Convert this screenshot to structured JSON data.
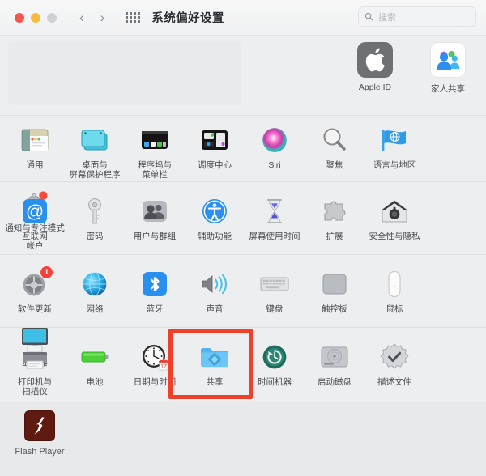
{
  "window": {
    "title": "系统偏好设置",
    "traffic_lights": [
      "close",
      "minimize",
      "zoom"
    ],
    "back_label": "‹",
    "forward_label": "›",
    "grid_icon": "grid-icon"
  },
  "search": {
    "placeholder": "搜索",
    "value": "",
    "icon": "search-icon"
  },
  "accounts": [
    {
      "label": "Apple ID",
      "icon": "apple-logo-icon"
    },
    {
      "label": "家人共享",
      "icon": "family-sharing-icon"
    }
  ],
  "sections": [
    {
      "name": "personal",
      "items": [
        {
          "label": "通用",
          "icon": "general-window-icon"
        },
        {
          "label": "桌面与\n屏幕保护程序",
          "icon": "desktop-screensaver-icon"
        },
        {
          "label": "程序坞与\n菜单栏",
          "icon": "dock-menubar-icon"
        },
        {
          "label": "调度中心",
          "icon": "mission-control-icon"
        },
        {
          "label": "Siri",
          "icon": "siri-icon"
        },
        {
          "label": "聚焦",
          "icon": "spotlight-icon"
        },
        {
          "label": "语言与地区",
          "icon": "language-region-flag-icon"
        },
        {
          "label": "通知与专注模式",
          "icon": "notifications-bell-icon"
        }
      ]
    },
    {
      "name": "accounts-access",
      "items": [
        {
          "label": "互联网\n帐户",
          "icon": "internet-accounts-at-icon"
        },
        {
          "label": "密码",
          "icon": "passwords-key-icon"
        },
        {
          "label": "用户与群组",
          "icon": "users-groups-icon"
        },
        {
          "label": "辅助功能",
          "icon": "accessibility-icon"
        },
        {
          "label": "屏幕使用时间",
          "icon": "screen-time-hourglass-icon"
        },
        {
          "label": "扩展",
          "icon": "extensions-puzzle-icon"
        },
        {
          "label": "安全性与隐私",
          "icon": "security-privacy-house-icon"
        }
      ]
    },
    {
      "name": "hardware",
      "items": [
        {
          "label": "软件更新",
          "icon": "software-update-gear-icon",
          "badge": "1"
        },
        {
          "label": "网络",
          "icon": "network-globe-icon"
        },
        {
          "label": "蓝牙",
          "icon": "bluetooth-icon"
        },
        {
          "label": "声音",
          "icon": "sound-speaker-icon"
        },
        {
          "label": "键盘",
          "icon": "keyboard-icon"
        },
        {
          "label": "触控板",
          "icon": "trackpad-icon"
        },
        {
          "label": "鼠标",
          "icon": "mouse-icon"
        },
        {
          "label": "显示器",
          "icon": "display-monitor-icon"
        }
      ]
    },
    {
      "name": "system",
      "items": [
        {
          "label": "打印机与\n扫描仪",
          "icon": "printer-scanner-icon"
        },
        {
          "label": "电池",
          "icon": "battery-icon"
        },
        {
          "label": "日期与时间",
          "icon": "date-time-clock-icon"
        },
        {
          "label": "共享",
          "icon": "sharing-folder-icon",
          "highlighted": true
        },
        {
          "label": "时间机器",
          "icon": "time-machine-icon"
        },
        {
          "label": "启动磁盘",
          "icon": "startup-disk-icon"
        },
        {
          "label": "描述文件",
          "icon": "profiles-check-icon"
        }
      ]
    }
  ],
  "third_party": {
    "items": [
      {
        "label": "Flash Player",
        "icon": "flash-player-icon"
      }
    ]
  },
  "annotation": {
    "highlight_color": "#f0402a",
    "target_label": "共享"
  }
}
